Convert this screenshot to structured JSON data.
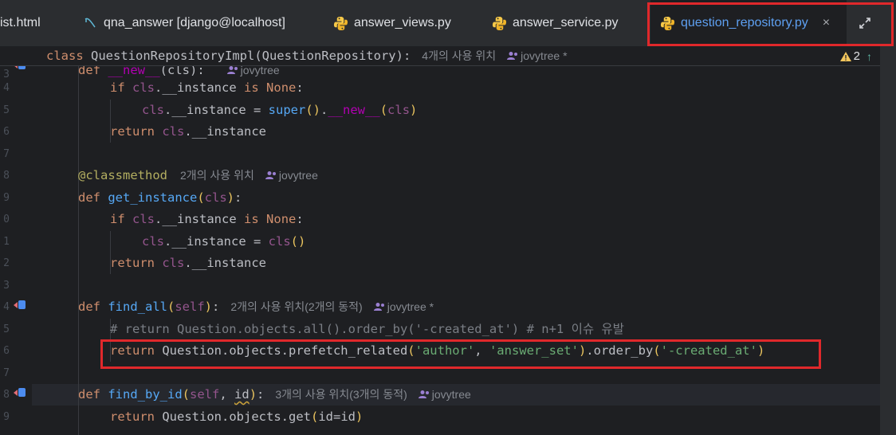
{
  "tabs": [
    {
      "label": "ist.html",
      "active": false,
      "icon": "html-file-icon"
    },
    {
      "label": "qna_answer [django@localhost]",
      "active": false,
      "icon": "database-console-icon"
    },
    {
      "label": "answer_views.py",
      "active": false,
      "icon": "python-file-icon"
    },
    {
      "label": "answer_service.py",
      "active": false,
      "icon": "python-file-icon"
    },
    {
      "label": "question_repository.py",
      "active": true,
      "icon": "python-file-icon",
      "close": "×"
    }
  ],
  "toolbar": {
    "expand_icon": "expand-editor-icon"
  },
  "warnings": {
    "count": "2"
  },
  "lines": [
    {
      "num": "0",
      "hint": "4개의 사용 위치",
      "author": "jovytree *"
    },
    {
      "num": "3",
      "hint": "",
      "author": "jovytree"
    },
    {
      "num": "4"
    },
    {
      "num": "5"
    },
    {
      "num": "6"
    },
    {
      "num": "7"
    },
    {
      "num": "8",
      "hint": "2개의 사용 위치",
      "author": "jovytree"
    },
    {
      "num": "9"
    },
    {
      "num": "0"
    },
    {
      "num": "1"
    },
    {
      "num": "2"
    },
    {
      "num": "3"
    },
    {
      "num": "4",
      "hint": "2개의 사용 위치(2개의 동적)",
      "author": "jovytree *"
    },
    {
      "num": "5"
    },
    {
      "num": "6"
    },
    {
      "num": "7"
    },
    {
      "num": "8",
      "hint": "3개의 사용 위치(3개의 동적)",
      "author": "jovytree"
    },
    {
      "num": "9"
    }
  ],
  "code": {
    "class_kw": "class",
    "class_name": "QuestionRepositoryImpl(QuestionRepository):",
    "l3_def": "def",
    "l3_name": "__new__",
    "l3_args": "(cls):",
    "if_kw": "if",
    "cls": "cls",
    "instance": ".__instance",
    "is_kw": "is",
    "none_kw": "None",
    "colon": ":",
    "assign": ".__instance = ",
    "super": "super",
    "new_call": "().__new__",
    "return_kw": "return",
    "classmethod": "@classmethod",
    "def_kw": "def",
    "get_instance": "get_instance",
    "find_all": "find_all",
    "find_by_id": "find_by_id",
    "self": "self",
    "id": "id",
    "comment": "# return Question.objects.all().order_by('-created_at') # n+1 이슈 유발",
    "prefetch": "Question.objects.prefetch_related",
    "author_str": "'author'",
    "answer_set_str": "'answer_set'",
    "order_by": ".order_by",
    "created_at_str": "'-created_at'",
    "get_call": "Question.objects.get",
    "id_eq": "id=id"
  }
}
